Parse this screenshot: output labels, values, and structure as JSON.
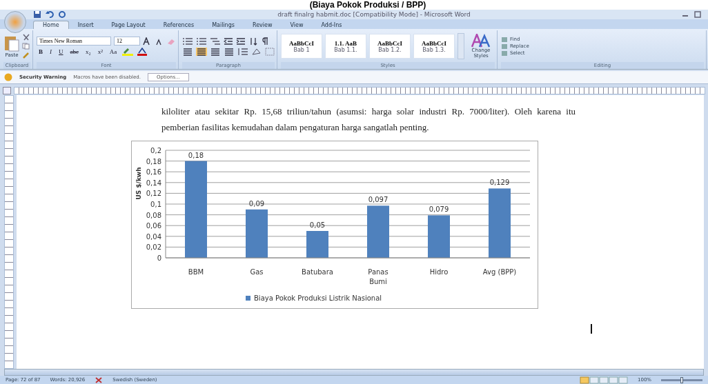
{
  "caption_above": "(Biaya Pokok Produksi / BPP)",
  "window": {
    "title": "draft finalrg habmit.doc [Compatibility Mode] - Microsoft Word"
  },
  "tabs": [
    {
      "label": "Home",
      "selected": true
    },
    {
      "label": "Insert",
      "selected": false
    },
    {
      "label": "Page Layout",
      "selected": false
    },
    {
      "label": "References",
      "selected": false
    },
    {
      "label": "Mailings",
      "selected": false
    },
    {
      "label": "Review",
      "selected": false
    },
    {
      "label": "View",
      "selected": false
    },
    {
      "label": "Add-Ins",
      "selected": false
    }
  ],
  "ribbon": {
    "clipboard": {
      "paste": "Paste",
      "label": "Clipboard"
    },
    "font": {
      "name": "Times New Roman",
      "size": "12",
      "format_buttons": [
        "B",
        "I",
        "U",
        "abe",
        "x₂",
        "x²",
        "Aa"
      ],
      "label": "Font"
    },
    "paragraph": {
      "label": "Paragraph",
      "alignments": [
        {
          "selected": false
        },
        {
          "selected": true
        },
        {
          "selected": false
        },
        {
          "selected": false
        }
      ]
    },
    "styles": {
      "items": [
        {
          "sample": "AaBbCcI",
          "name": "Bab 1"
        },
        {
          "sample": "1.1.  AaB",
          "name": "Bab 1.1."
        },
        {
          "sample": "AaBbCcI",
          "name": "Bab 1.2."
        },
        {
          "sample": "AaBbCcI",
          "name": "Bab 1.3."
        }
      ],
      "change_styles": "Change Styles",
      "label": "Styles"
    },
    "editing": {
      "items": [
        "Find",
        "Replace",
        "Select"
      ],
      "label": "Editing"
    }
  },
  "security_bar": {
    "title": "Security Warning",
    "message": "Macros have been disabled.",
    "button": "Options..."
  },
  "document": {
    "paragraph": "kiloliter atau sekitar Rp. 15,68 triliun/tahun (asumsi: harga solar industri Rp. 7000/liter). Oleh karena itu pemberian fasilitas kemudahan dalam pengaturan harga sangatlah penting.",
    "chart_data": {
      "type": "bar",
      "ylabel": "US $/kwh",
      "categories": [
        "BBM",
        "Gas",
        "Batubara",
        "Panas Bumi",
        "Hidro",
        "Avg (BPP)"
      ],
      "series": [
        {
          "name": "Biaya Pokok Produksi Listrik Nasional",
          "color": "#4f81bd",
          "values": [
            0.18,
            0.09,
            0.05,
            0.097,
            0.079,
            0.129
          ]
        }
      ],
      "ylim": [
        0,
        0.2
      ],
      "grid": true,
      "yticks": [
        {
          "value": 0,
          "label": "0"
        },
        {
          "value": 0.02,
          "label": "0,02"
        },
        {
          "value": 0.04,
          "label": "0,04"
        },
        {
          "value": 0.06,
          "label": "0,06"
        },
        {
          "value": 0.08,
          "label": "0,08"
        },
        {
          "value": 0.1,
          "label": "0,1"
        },
        {
          "value": 0.12,
          "label": "0,12"
        },
        {
          "value": 0.14,
          "label": "0,14"
        },
        {
          "value": 0.16,
          "label": "0,16"
        },
        {
          "value": 0.18,
          "label": "0,18"
        },
        {
          "value": 0.2,
          "label": "0,2"
        }
      ],
      "value_labels": [
        "0,18",
        "0,09",
        "0,05",
        "0,097",
        "0,079",
        "0,129"
      ]
    }
  },
  "status_bar": {
    "page": "Page: 72 of 87",
    "words": "Words: 20,926",
    "language": "Swedish (Sweden)",
    "zoom": "100%",
    "zoom_slider": {
      "level": 0.5
    }
  }
}
